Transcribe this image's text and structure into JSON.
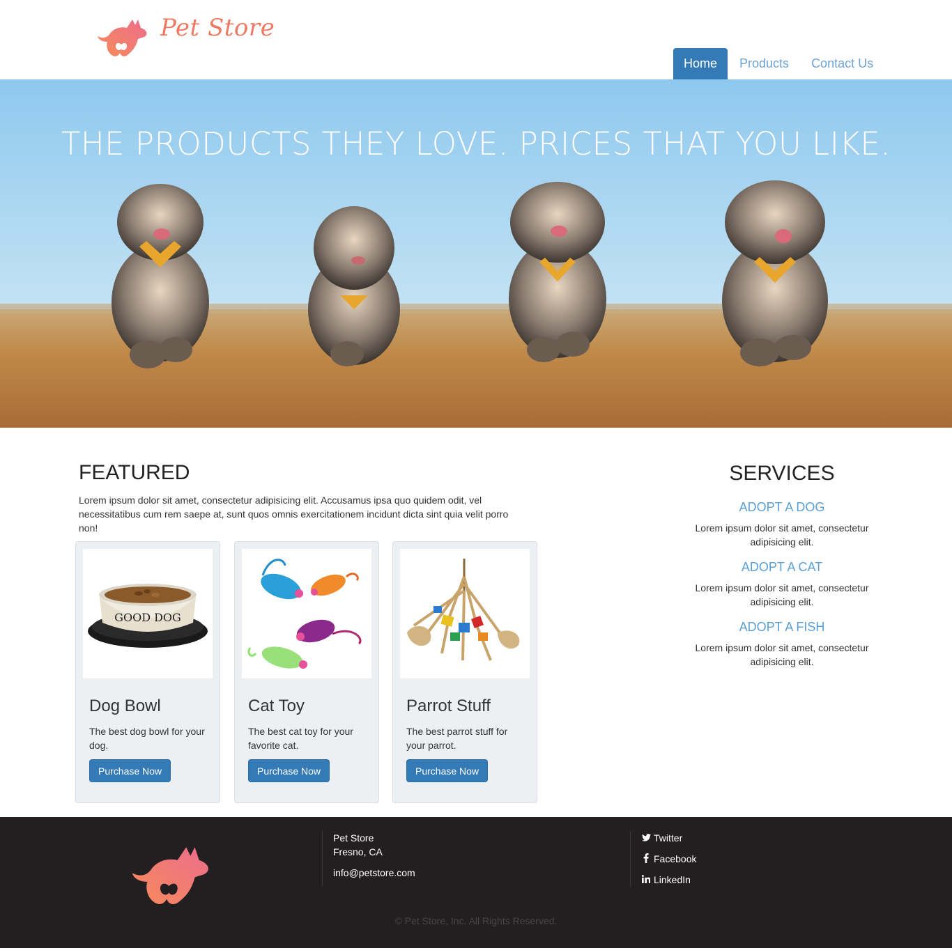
{
  "brand": {
    "name": "Pet Store",
    "accent": "#ee7a64"
  },
  "nav": {
    "items": [
      {
        "label": "Home",
        "active": true
      },
      {
        "label": "Products",
        "active": false
      },
      {
        "label": "Contact Us",
        "active": false
      }
    ]
  },
  "hero": {
    "headline": "THE PRODUCTS THEY LOVE. PRICES THAT YOU LIKE."
  },
  "featured": {
    "title": "FEATURED",
    "intro": "Lorem ipsum dolor sit amet, consectetur adipisicing elit. Accusamus ipsa quo quidem odit, vel necessitatibus cum rem saepe at, sunt quos omnis exercitationem incidunt dicta sint quia velit porro non!",
    "cards": [
      {
        "title": "Dog Bowl",
        "description": "The best dog bowl for your dog.",
        "button": "Purchase Now",
        "image": "dog-bowl"
      },
      {
        "title": "Cat Toy",
        "description": "The best cat toy for your favorite cat.",
        "button": "Purchase Now",
        "image": "cat-toy-mice"
      },
      {
        "title": "Parrot Stuff",
        "description": "The best parrot stuff for your parrot.",
        "button": "Purchase Now",
        "image": "parrot-toy"
      }
    ],
    "bowl_text": "GOOD DOG"
  },
  "services": {
    "title": "SERVICES",
    "items": [
      {
        "name": "ADOPT A DOG",
        "description": "Lorem ipsum dolor sit amet, consectetur adipisicing elit."
      },
      {
        "name": "ADOPT A CAT",
        "description": "Lorem ipsum dolor sit amet, consectetur adipisicing elit."
      },
      {
        "name": "ADOPT A FISH",
        "description": "Lorem ipsum dolor sit amet, consectetur adipisicing elit."
      }
    ]
  },
  "footer": {
    "company": "Pet Store",
    "city": "Fresno, CA",
    "email": "info@petstore.com",
    "social": [
      {
        "label": "Twitter",
        "icon": "twitter-icon"
      },
      {
        "label": "Facebook",
        "icon": "facebook-icon"
      },
      {
        "label": "LinkedIn",
        "icon": "linkedin-icon"
      }
    ],
    "copyright": "© Pet Store, Inc. All Rights Reserved."
  }
}
